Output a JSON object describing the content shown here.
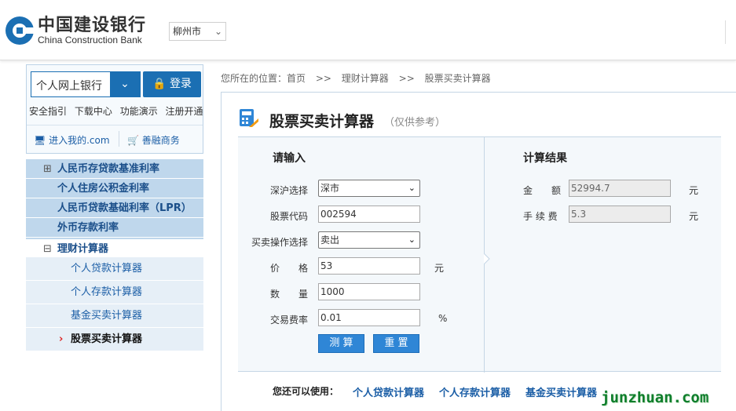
{
  "header": {
    "brand_cn": "中国建设银行",
    "brand_en": "China Construction Bank",
    "city": "柳州市",
    "brand_color": "#1b6fb3"
  },
  "login": {
    "bank_select": "个人网上银行",
    "login_label": "登录",
    "quick_links": [
      "安全指引",
      "下载中心",
      "功能演示",
      "注册开通"
    ],
    "enter_mine": "进入我的.com",
    "shanrong": "善融商务"
  },
  "sidebar": {
    "menu": [
      {
        "label": "人民币存贷款基准利率",
        "marker": "⊞"
      },
      {
        "label": "个人住房公积金利率",
        "marker": ""
      },
      {
        "label": "人民币贷款基础利率（LPR）",
        "marker": ""
      },
      {
        "label": "外币存款利率",
        "marker": ""
      },
      {
        "label": "理财计算器",
        "marker": "⊟"
      }
    ],
    "sub_items": [
      {
        "label": "个人贷款计算器"
      },
      {
        "label": "个人存款计算器"
      },
      {
        "label": "基金买卖计算器"
      },
      {
        "label": "股票买卖计算器",
        "current": true,
        "marker": "›"
      }
    ]
  },
  "breadcrumb": {
    "prefix": "您所在的位置：",
    "items": [
      "首页",
      "理财计算器",
      "股票买卖计算器"
    ],
    "separator": ">>"
  },
  "calculator": {
    "title": "股票买卖计算器",
    "note": "（仅供参考）",
    "input_section": "请输入",
    "result_section": "计算结果",
    "fields": {
      "market_label": "深沪选择",
      "market_value": "深市",
      "code_label": "股票代码",
      "code_value": "002594",
      "op_label": "买卖操作选择",
      "op_value": "卖出",
      "price_label": "价　　格",
      "price_value": "53",
      "price_unit": "元",
      "qty_label": "数　　量",
      "qty_value": "1000",
      "fee_label": "交易费率",
      "fee_value": "0.01",
      "fee_unit": "%"
    },
    "buttons": {
      "calc": "测 算",
      "reset": "重 置"
    },
    "results": {
      "amount_label": "金　　额",
      "amount_value": "52994.7",
      "amount_unit": "元",
      "fee_label": "手 续 费",
      "fee_value": "5.3",
      "fee_unit": "元"
    },
    "also_use_label": "您还可以使用：",
    "also_use_links": [
      "个人贷款计算器",
      "个人存款计算器",
      "基金买卖计算器"
    ]
  },
  "watermark": "junzhuan.com"
}
